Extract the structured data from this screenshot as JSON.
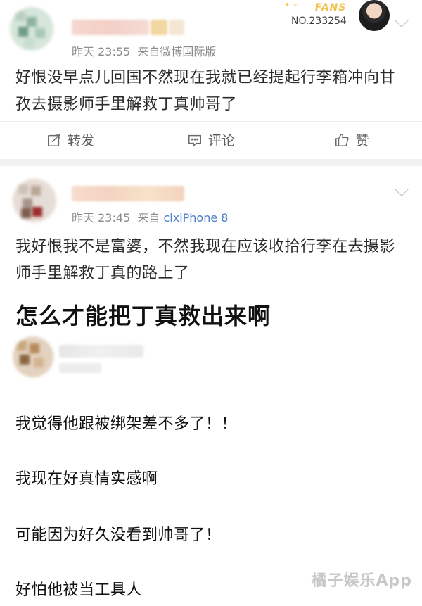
{
  "comment1": {
    "time": "昨天 23:55",
    "source": "来自微博国际版",
    "text": "好恨没早点儿回国不然现在我就已经提起行李箱冲向甘孜去摄影师手里解救丁真帅哥了",
    "fans_badge": {
      "title": "FANS",
      "number": "NO.233254"
    }
  },
  "actions": {
    "repost": "转发",
    "comment": "评论",
    "like": "赞"
  },
  "comment2": {
    "time": "昨天 23:45",
    "source_prefix": "来自",
    "source_link": "clxiPhone 8",
    "text": "我好恨我不是富婆，不然我现在应该收拾行李在去摄影师手里解救丁真的路上了"
  },
  "headline": "怎么才能把丁真救出来啊",
  "comments": [
    "我觉得他跟被绑架差不多了！！",
    "我现在好真情实感啊",
    "可能因为好久没看到帅哥了！",
    "好怕他被当工具人"
  ],
  "watermark": "橘子娱乐App"
}
